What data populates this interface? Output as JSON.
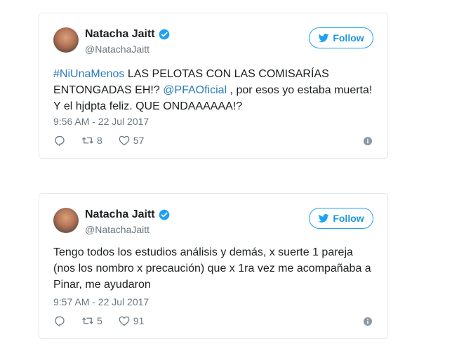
{
  "tweets": [
    {
      "author": {
        "name": "Natacha Jaitt",
        "handle": "@NatachaJaitt",
        "verified": true
      },
      "follow_label": "Follow",
      "text": {
        "hashtag": "#NiUnaMenos",
        "part1": " LAS PELOTAS CON LAS COMISARÍAS ENTONGADAS EH!? ",
        "mention": "@PFAOficial",
        "part2": " , por esos yo estaba muerta! Y el hjdpta feliz. QUE ONDAAAAAA!?"
      },
      "timestamp": "9:56 AM - 22 Jul 2017",
      "retweets": "8",
      "likes": "57"
    },
    {
      "author": {
        "name": "Natacha Jaitt",
        "handle": "@NatachaJaitt",
        "verified": true
      },
      "follow_label": "Follow",
      "text": {
        "body": "Tengo todos los estudios análisis y demás, x suerte 1 pareja (nos los nombro x precaución) que x 1ra vez me acompañaba a Pinar, me ayudaron"
      },
      "timestamp": "9:57 AM - 22 Jul 2017",
      "retweets": "5",
      "likes": "91"
    }
  ],
  "colors": {
    "accent": "#1da1f2",
    "link": "#2b7bb9",
    "muted": "#697882",
    "text": "#1c2022",
    "border": "#e1e8ed"
  },
  "icons": [
    "verified-icon",
    "twitter-bird-icon",
    "reply-icon",
    "retweet-icon",
    "heart-icon",
    "info-icon"
  ]
}
